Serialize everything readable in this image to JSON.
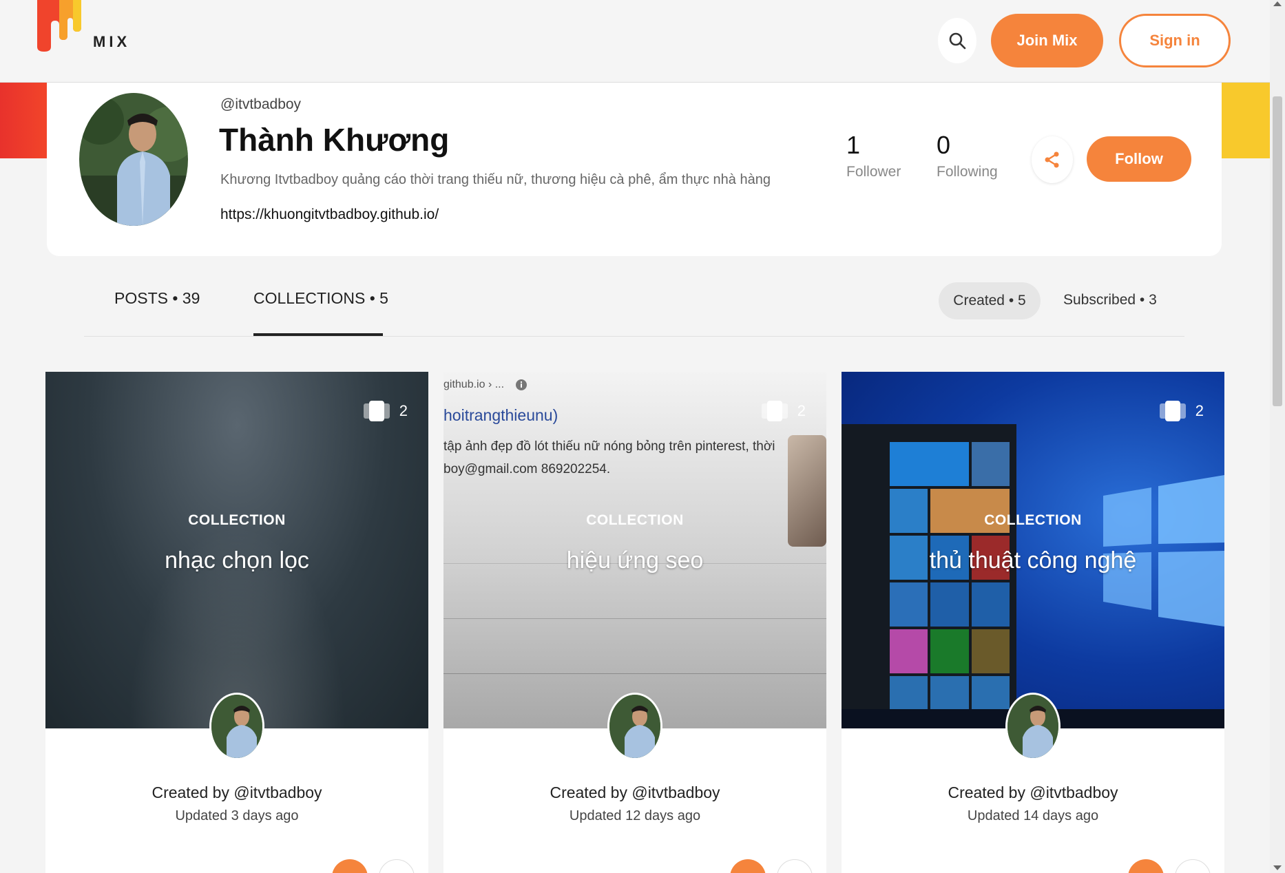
{
  "brand": {
    "logo_text": "MIX",
    "accent": "#f5843c"
  },
  "header": {
    "join_label": "Join Mix",
    "signin_label": "Sign in"
  },
  "profile": {
    "handle": "@itvtbadboy",
    "name": "Thành Khương",
    "bio": "Khương Itvtbadboy quảng cáo thời trang thiếu nữ, thương hiệu cà phê, ẩm thực nhà hàng",
    "link": "https://khuongitvtbadboy.github.io/",
    "followers": {
      "count": "1",
      "label": "Follower"
    },
    "following": {
      "count": "0",
      "label": "Following"
    },
    "follow_label": "Follow"
  },
  "tabs": {
    "posts": "POSTS • 39",
    "collections": "COLLECTIONS • 5",
    "created": "Created • 5",
    "subscribed": "Subscribed • 3"
  },
  "cards": [
    {
      "count": "2",
      "label": "COLLECTION",
      "title": "nhạc chọn lọc",
      "created_by": "Created by @itvtbadboy",
      "updated": "Updated 3 days ago"
    },
    {
      "count": "2",
      "label": "COLLECTION",
      "title": "hiệu ứng seo",
      "created_by": "Created by @itvtbadboy",
      "updated": "Updated 12 days ago",
      "preview": {
        "site": "github.io › ...",
        "heading": "hoitrangthieunu)",
        "line1": "tập ảnh đẹp đồ lót thiếu nữ nóng bỏng trên pinterest, thời",
        "line2": "boy@gmail.com 869202254."
      }
    },
    {
      "count": "2",
      "label": "COLLECTION",
      "title": "thủ thuật công nghệ",
      "created_by": "Created by @itvtbadboy",
      "updated": "Updated 14 days ago"
    }
  ]
}
